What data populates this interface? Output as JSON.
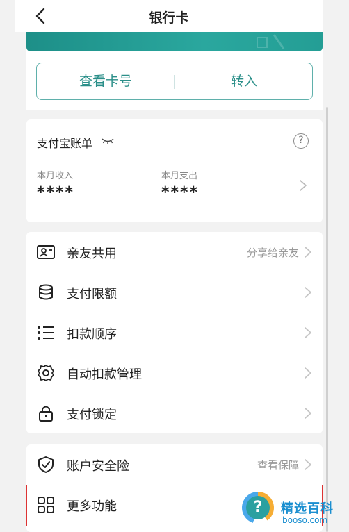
{
  "header": {
    "title": "银行卡",
    "back_icon": "chevron-left-icon"
  },
  "card_actions": {
    "view_card_number": "查看卡号",
    "transfer_in": "转入"
  },
  "bill": {
    "title": "支付宝账单",
    "income_label": "本月收入",
    "income_value": "****",
    "expense_label": "本月支出",
    "expense_value": "****"
  },
  "menu": [
    {
      "label": "亲友共用",
      "right_text": "分享给亲友",
      "icon": "id-card-icon"
    },
    {
      "label": "支付限额",
      "right_text": "",
      "icon": "database-icon"
    },
    {
      "label": "扣款顺序",
      "right_text": "",
      "icon": "list-icon"
    },
    {
      "label": "自动扣款管理",
      "right_text": "",
      "icon": "gear-icon"
    },
    {
      "label": "支付锁定",
      "right_text": "",
      "icon": "lock-icon"
    }
  ],
  "menu2": [
    {
      "label": "账户安全险",
      "right_text": "查看保障",
      "icon": "shield-check-icon"
    },
    {
      "label": "更多功能",
      "right_text": "",
      "icon": "grid-icon"
    }
  ],
  "watermark": {
    "text": "精选百科",
    "sub": "booso.com"
  },
  "colors": {
    "accent": "#2b8f89",
    "highlight_border": "#dd3333",
    "banner": "#1d8f88"
  }
}
